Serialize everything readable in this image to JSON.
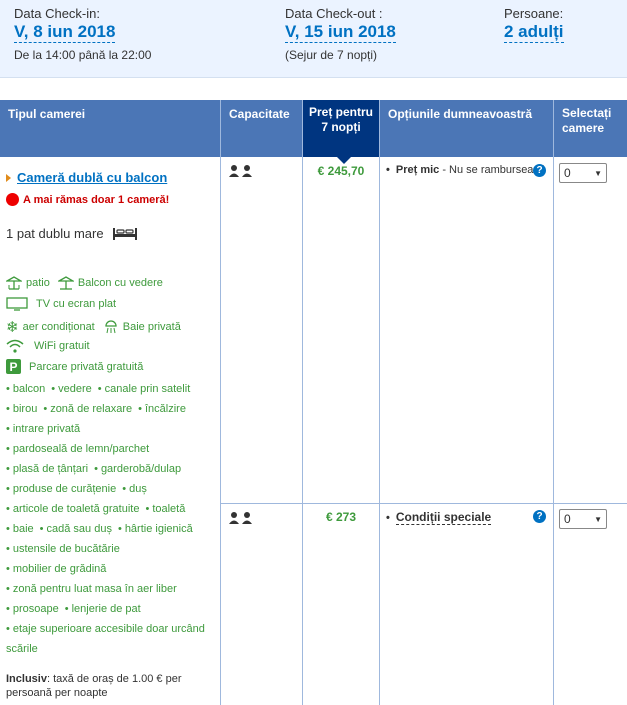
{
  "stay": {
    "checkin": {
      "label": "Data Check-in:",
      "date": "V, 8 iun 2018",
      "note": "De la 14:00 până la 22:00"
    },
    "checkout": {
      "label": "Data Check-out :",
      "date": "V, 15 iun 2018",
      "note": "(Sejur de 7 nopți)"
    },
    "guests": {
      "label": "Persoane:",
      "value": "2 adulți"
    }
  },
  "table": {
    "headers": {
      "room_type": "Tipul camerei",
      "capacity": "Capacitate",
      "price": "Preț pentru 7 nopți",
      "options": "Opțiunile dumneavoastră",
      "select": "Selectați camere"
    }
  },
  "room": {
    "name": "Cameră dublă cu balcon",
    "scarcity": "A mai rămas doar 1 cameră!",
    "bed": "1 pat dublu mare",
    "facilities": [
      {
        "icon": "patio-icon",
        "label": "patio"
      },
      {
        "icon": "balcony-icon",
        "label": "Balcon cu vedere"
      },
      {
        "icon": "tv-icon",
        "label": "TV cu ecran plat"
      },
      {
        "icon": "snowflake-icon",
        "label": "aer condiționat"
      },
      {
        "icon": "shower-icon",
        "label": "Baie privată"
      },
      {
        "icon": "wifi-icon",
        "label": "WiFi gratuit"
      },
      {
        "icon": "parking-icon",
        "label": "Parcare privată gratuită"
      }
    ],
    "amenities": [
      [
        "balcon",
        "vedere",
        "canale prin satelit"
      ],
      [
        "birou",
        "zonă de relaxare",
        "încălzire"
      ],
      [
        "intrare privată"
      ],
      [
        "pardoseală de lemn/parchet"
      ],
      [
        "plasă de țânțari",
        "garderobă/dulap"
      ],
      [
        "produse de curățenie",
        "duș"
      ],
      [
        "articole de toaletă gratuite",
        "toaletă"
      ],
      [
        "baie",
        "cadă sau duș",
        "hârtie igienică"
      ],
      [
        "ustensile de bucătărie"
      ],
      [
        "mobilier de grădină"
      ],
      [
        "zonă pentru luat masa în aer liber"
      ],
      [
        "prosoape",
        "lenjerie de pat"
      ],
      [
        "etaje superioare accesibile doar urcând"
      ],
      [
        "scările"
      ]
    ],
    "included_label": "Inclusiv",
    "included_text": ": taxă de oraș de 1.00 € per persoană per noapte"
  },
  "offers": [
    {
      "price": "€ 245,70",
      "option_bold": "Preț mic",
      "option_rest": " - Nu se rambursează",
      "help": "?",
      "select_value": "0"
    },
    {
      "price": "€ 273",
      "option_bold": "Condiții speciale",
      "option_rest": "",
      "help": "?",
      "select_value": "0"
    }
  ],
  "colors": {
    "header_blue": "#4b76b6",
    "price_header": "#003580",
    "link": "#0071c2",
    "green": "#3e9a3c"
  }
}
